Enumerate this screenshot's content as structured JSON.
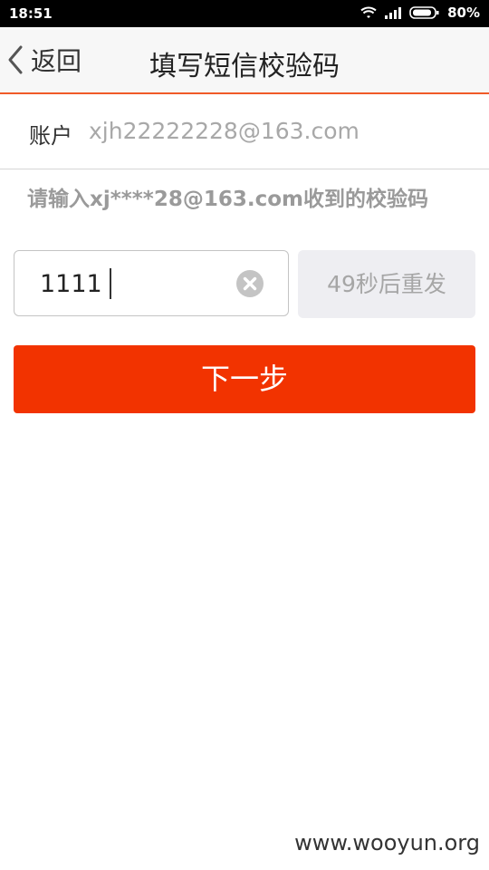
{
  "status_bar": {
    "time": "18:51",
    "battery": "80%",
    "icons": [
      "wifi-icon",
      "signal-icon",
      "battery-icon"
    ]
  },
  "nav": {
    "back_label": "返回",
    "title": "填写短信校验码"
  },
  "account": {
    "label": "账户",
    "value": "xjh22222228@163.com"
  },
  "hint": "请输入xj****28@163.com收到的校验码",
  "code_field": {
    "value": "1111",
    "clear_icon": "clear-icon"
  },
  "resend": {
    "label": "49秒后重发",
    "seconds_remaining": 49
  },
  "next_button": {
    "label": "下一步"
  },
  "watermark": "www.wooyun.org",
  "colors": {
    "accent": "#f23300",
    "nav_divider": "#f05a28",
    "hint": "#9a9a9a",
    "disabled_bg": "#eeeef2"
  }
}
